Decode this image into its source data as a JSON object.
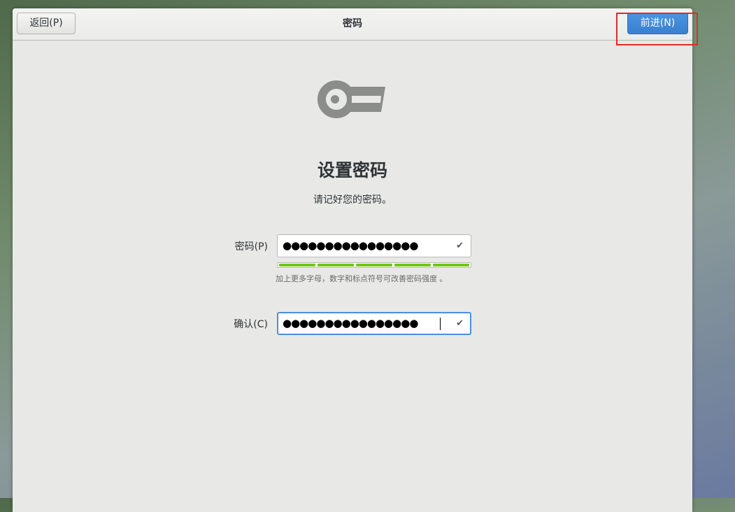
{
  "header": {
    "back_label": "返回(P)",
    "title": "密码",
    "next_label": "前进(N)"
  },
  "main": {
    "title": "设置密码",
    "subtitle": "请记好您的密码。",
    "password": {
      "label": "密码(P)",
      "masked_value": "●●●●●●●●●●●●●●●●",
      "strength_fraction": 1.0,
      "strength_segments": 5,
      "strength_color": "#73c416",
      "hint": "加上更多字母，数字和标点符号可改善密码强度 。"
    },
    "confirm": {
      "label": "确认(C)",
      "masked_value": "●●●●●●●●●●●●●●●●"
    }
  },
  "colors": {
    "accent": "#3a80d0",
    "highlight_box": "#e02a2a"
  },
  "icons": {
    "key": "key-icon",
    "check": "checkmark-icon"
  }
}
